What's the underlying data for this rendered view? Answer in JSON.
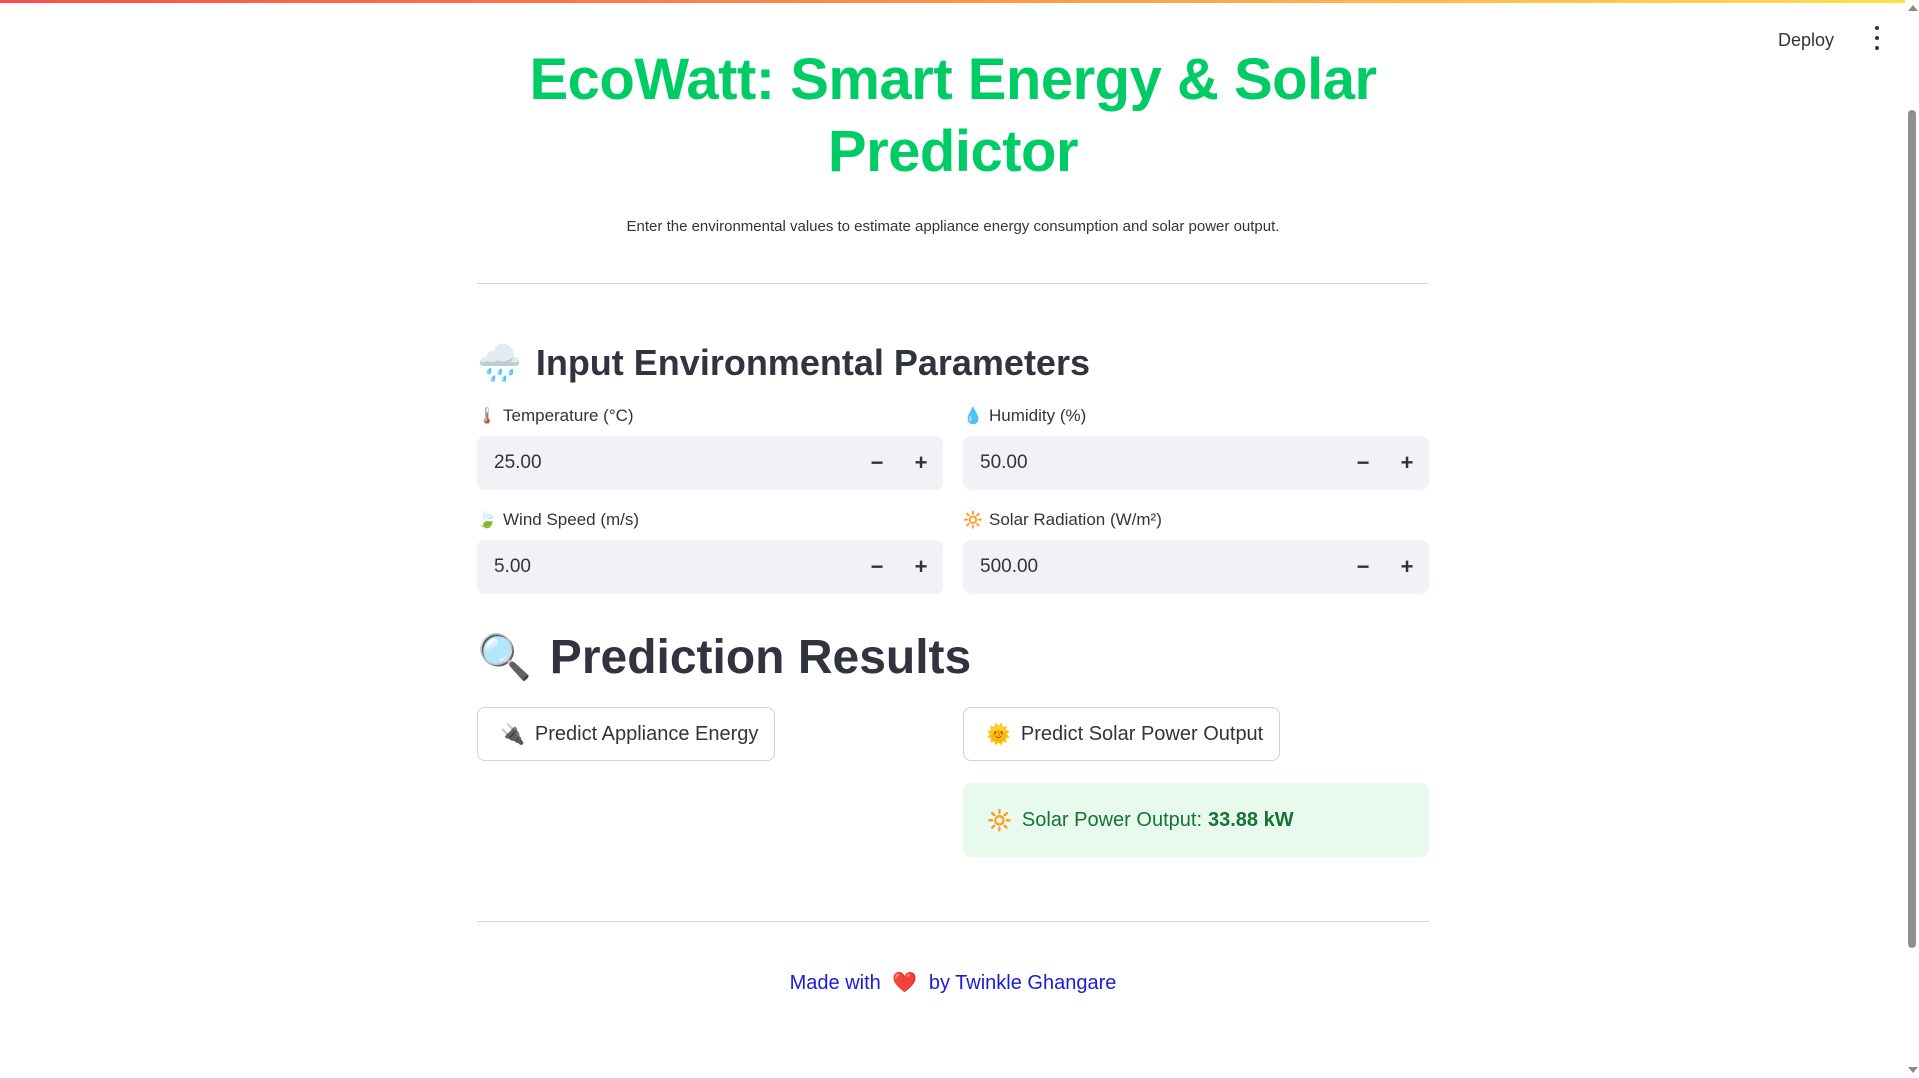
{
  "header": {
    "deploy_label": "Deploy",
    "menu_icon": "kebab-menu-icon"
  },
  "app": {
    "title": "EcoWatt: Smart Energy & Solar Predictor",
    "subtitle": "Enter the environmental values to estimate appliance energy consumption and solar power output."
  },
  "inputs_section": {
    "icon": "🌧️",
    "heading": "Input Environmental Parameters",
    "fields": [
      {
        "icon": "🌡️",
        "label": "Temperature (°C)",
        "value": "25.00"
      },
      {
        "icon": "💧",
        "label": "Humidity (%)",
        "value": "50.00"
      },
      {
        "icon": "🍃",
        "label": "Wind Speed (m/s)",
        "value": "5.00"
      },
      {
        "icon": "🔆",
        "label": "Solar Radiation (W/m²)",
        "value": "500.00"
      }
    ],
    "minus_symbol": "−",
    "plus_symbol": "+"
  },
  "results_section": {
    "icon": "🔍",
    "heading": "Prediction Results",
    "appliance_button": {
      "icon": "🔌",
      "label": "Predict Appliance Energy"
    },
    "solar_button": {
      "icon": "🌞",
      "label": "Predict Solar Power Output"
    },
    "solar_result": {
      "icon": "🔆",
      "label": "Solar Power Output:",
      "value": "33.88 kW"
    }
  },
  "footer": {
    "prefix": "Made with",
    "heart": "❤️",
    "suffix": "by Twinkle Ghangare"
  },
  "colors": {
    "title_green": "#00cc66",
    "success_bg": "#e8f9ee",
    "success_text": "#177233",
    "footer_link": "#1a1adb"
  }
}
